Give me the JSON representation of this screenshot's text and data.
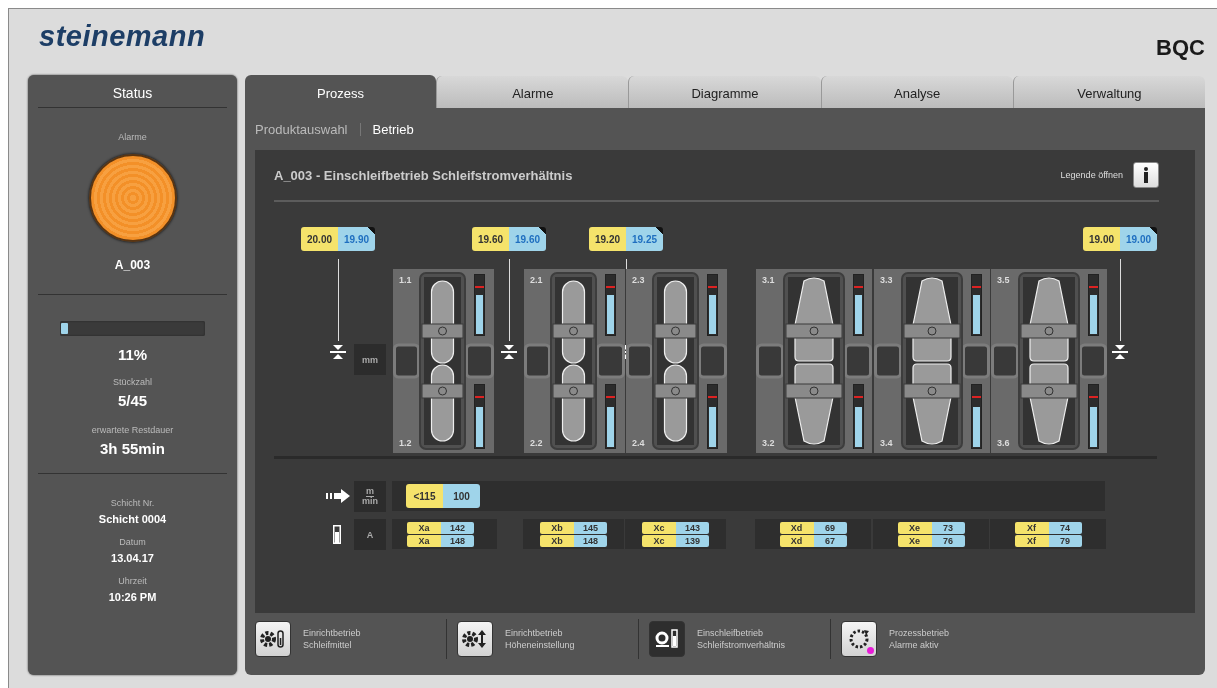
{
  "header": {
    "logo": "steinemann",
    "product": "BQC"
  },
  "status": {
    "title": "Status",
    "alarm_label": "Alarme",
    "alarm_code": "A_003",
    "progress": {
      "level": 0.05,
      "percent": "11%"
    },
    "fields": [
      {
        "label": "Stückzahl",
        "value": "5/45"
      },
      {
        "label": "erwartete Restdauer",
        "value": "3h 55min"
      }
    ],
    "shift": [
      {
        "label": "Schicht Nr.",
        "value": "Schicht 0004"
      },
      {
        "label": "Datum",
        "value": "13.04.17"
      },
      {
        "label": "Uhrzeit",
        "value": "10:26 PM"
      }
    ]
  },
  "tabs": [
    {
      "label": "Prozess",
      "selected": true
    },
    {
      "label": "Alarme",
      "selected": false
    },
    {
      "label": "Diagramme",
      "selected": false
    },
    {
      "label": "Analyse",
      "selected": false
    },
    {
      "label": "Verwaltung",
      "selected": false
    }
  ],
  "subtabs": [
    {
      "label": "Produktauswahl",
      "selected": false
    },
    {
      "label": "Betrieb",
      "selected": true
    }
  ],
  "diagram": {
    "title": "A_003 - Einschleifbetrieb Schleifstromverhältnis",
    "legend_label": "Legende öffnen",
    "gauge_unit": "mm",
    "gauges": [
      {
        "set": "20.00",
        "actual": "19.90"
      },
      {
        "set": "19.60",
        "actual": "19.60"
      },
      {
        "set": "19.20",
        "actual": "19.25"
      },
      {
        "set": "19.00",
        "actual": "19.00"
      }
    ],
    "units": [
      {
        "kind": "narrow",
        "labels": [
          "1.1",
          "1.2"
        ],
        "meters": [
          {
            "level": 0.65
          },
          {
            "level": 0.63
          }
        ]
      },
      {
        "kind": "narrow",
        "labels": [
          "2.1",
          "2.2"
        ],
        "meters": [
          {
            "level": 0.65
          },
          {
            "level": 0.63
          }
        ]
      },
      {
        "kind": "narrow",
        "labels": [
          "2.3",
          "2.4"
        ],
        "meters": [
          {
            "level": 0.65
          },
          {
            "level": 0.63
          }
        ]
      },
      {
        "kind": "wide",
        "labels": [
          "3.1",
          "3.2"
        ],
        "meters": [
          {
            "level": 0.65
          },
          {
            "level": 0.63
          }
        ]
      },
      {
        "kind": "wide",
        "labels": [
          "3.3",
          "3.4"
        ],
        "meters": [
          {
            "level": 0.65
          },
          {
            "level": 0.63
          }
        ]
      },
      {
        "kind": "wide",
        "labels": [
          "3.5",
          "3.6"
        ],
        "meters": [
          {
            "level": 0.65
          },
          {
            "level": 0.63
          }
        ]
      }
    ],
    "speed": {
      "unit_top": "m",
      "unit_bottom": "min",
      "set": "<115",
      "actual": "100"
    },
    "current": {
      "unit": "A",
      "cells": [
        {
          "rows": [
            {
              "label": "Xa",
              "value": "142"
            },
            {
              "label": "Xa",
              "value": "148"
            }
          ]
        },
        {
          "rows": [
            {
              "label": "Xb",
              "value": "145"
            },
            {
              "label": "Xb",
              "value": "148"
            }
          ]
        },
        {
          "rows": [
            {
              "label": "Xc",
              "value": "143"
            },
            {
              "label": "Xc",
              "value": "139"
            }
          ]
        },
        {
          "rows": [
            {
              "label": "Xd",
              "value": "69"
            },
            {
              "label": "Xd",
              "value": "67"
            }
          ]
        },
        {
          "rows": [
            {
              "label": "Xe",
              "value": "73"
            },
            {
              "label": "Xe",
              "value": "76"
            }
          ]
        },
        {
          "rows": [
            {
              "label": "Xf",
              "value": "74"
            },
            {
              "label": "Xf",
              "value": "79"
            }
          ]
        }
      ]
    }
  },
  "modes": [
    {
      "kind": "setup-abrasive",
      "title": "Einrichtbetrieb",
      "subtitle": "Schleifmittel",
      "selected": false,
      "alarm": false
    },
    {
      "kind": "setup-height",
      "title": "Einrichtbetrieb",
      "subtitle": "Höheneinstellung",
      "selected": false,
      "alarm": false
    },
    {
      "kind": "grinding-in",
      "title": "Einschleifbetrieb",
      "subtitle": "Schleifstromverhältnis",
      "selected": true,
      "alarm": false
    },
    {
      "kind": "process",
      "title": "Prozessbetrieb",
      "subtitle": "Alarme aktiv",
      "selected": false,
      "alarm": true
    }
  ]
}
